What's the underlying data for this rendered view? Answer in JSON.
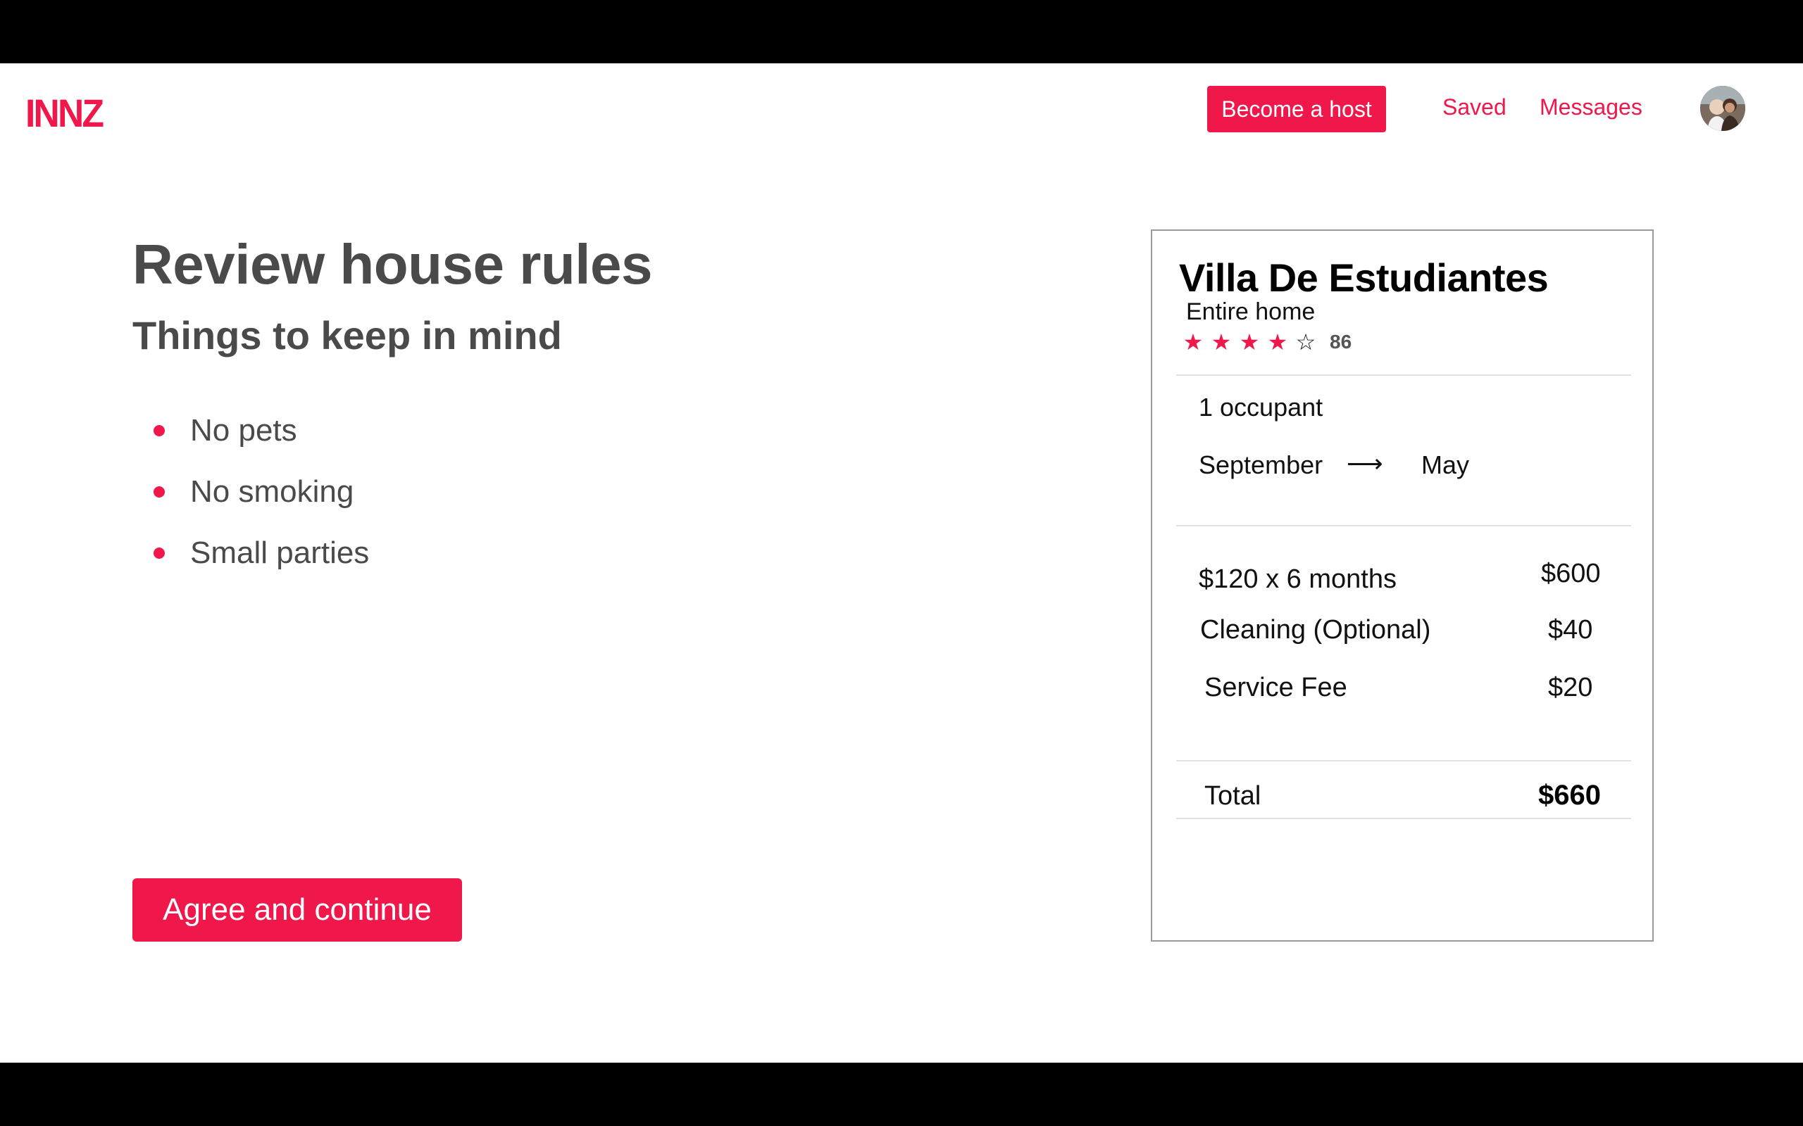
{
  "brand": {
    "logo": "INNZ",
    "accent": "#f0184a"
  },
  "nav": {
    "host_button": "Become a host",
    "saved": "Saved",
    "messages": "Messages"
  },
  "main": {
    "title": "Review house rules",
    "subtitle": "Things to keep in mind",
    "rules": [
      "No pets",
      "No smoking",
      "Small parties"
    ],
    "agree_button": "Agree and continue"
  },
  "listing": {
    "name": "Villa De Estudiantes",
    "type": "Entire home",
    "rating": 4,
    "rating_max": 5,
    "review_count": "86",
    "occupants": "1 occupant",
    "start": "September",
    "end": "May",
    "arrow": "⟶",
    "line_items": [
      {
        "label": "$120 x 6 months",
        "value": "$600"
      },
      {
        "label": "Cleaning (Optional)",
        "value": "$40"
      },
      {
        "label": "Service Fee",
        "value": "$20"
      }
    ],
    "total_label": "Total",
    "total_value": "$660"
  }
}
